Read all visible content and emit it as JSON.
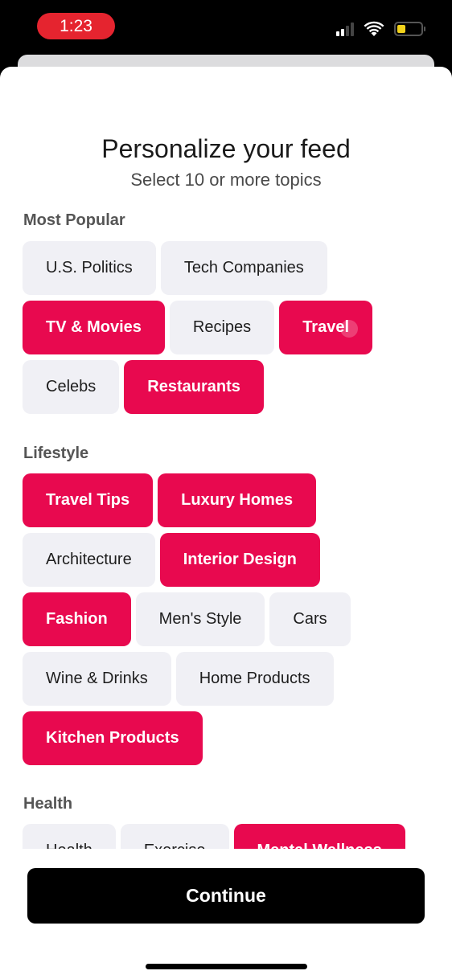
{
  "status_bar": {
    "time": "1:23",
    "time_pill_color": "#e5242f",
    "icons": [
      "cellular-signal-icon",
      "wifi-icon",
      "battery-icon"
    ],
    "battery_level": 0.25,
    "battery_color": "#f2d21b"
  },
  "header": {
    "title": "Personalize your feed",
    "subtitle": "Select 10 or more topics"
  },
  "colors": {
    "selected_chip": "#e8094f",
    "unselected_chip": "#f0f0f5",
    "continue_button": "#000000"
  },
  "sections": [
    {
      "label": "Most Popular",
      "topics": [
        {
          "label": "U.S. Politics",
          "selected": false
        },
        {
          "label": "Tech Companies",
          "selected": false
        },
        {
          "label": "TV & Movies",
          "selected": true
        },
        {
          "label": "Recipes",
          "selected": false
        },
        {
          "label": "Travel",
          "selected": true
        },
        {
          "label": "Celebs",
          "selected": false
        },
        {
          "label": "Restaurants",
          "selected": true
        }
      ]
    },
    {
      "label": "Lifestyle",
      "topics": [
        {
          "label": "Travel Tips",
          "selected": true
        },
        {
          "label": "Luxury Homes",
          "selected": true
        },
        {
          "label": "Architecture",
          "selected": false
        },
        {
          "label": "Interior Design",
          "selected": true
        },
        {
          "label": "Fashion",
          "selected": true
        },
        {
          "label": "Men's Style",
          "selected": false
        },
        {
          "label": "Cars",
          "selected": false
        },
        {
          "label": "Wine & Drinks",
          "selected": false
        },
        {
          "label": "Home Products",
          "selected": false
        },
        {
          "label": "Kitchen Products",
          "selected": true
        }
      ]
    },
    {
      "label": "Health",
      "topics": [
        {
          "label": "Health",
          "selected": false
        },
        {
          "label": "Exercise",
          "selected": false
        },
        {
          "label": "Mental Wellness",
          "selected": true
        }
      ]
    }
  ],
  "footer": {
    "continue_label": "Continue"
  }
}
